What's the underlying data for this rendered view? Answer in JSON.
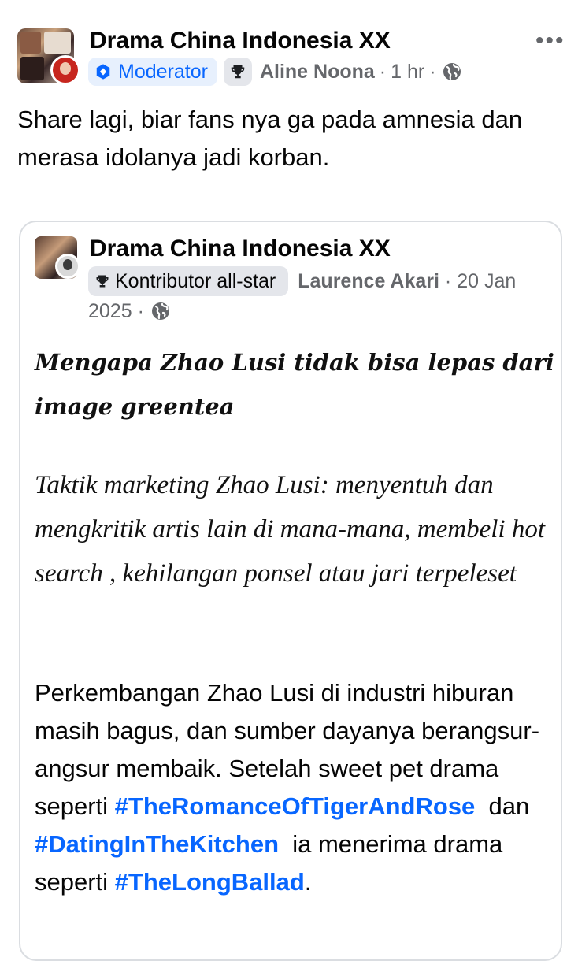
{
  "post": {
    "group_name": "Drama China Indonesia XX",
    "role_badge": "Moderator",
    "author": "Aline Noona",
    "time": "1 hr",
    "separator": "·",
    "more_icon": "more-horizontal-icon",
    "text": "Share lagi, biar fans nya ga pada amnesia dan merasa idolanya jadi korban."
  },
  "shared": {
    "group_name": "Drama China Indonesia XX",
    "role_badge": "Kontributor all-star",
    "author": "Laurence Akari",
    "date": "20 Jan 2025",
    "separator": "·",
    "title": "Mengapa Zhao Lusi tidak bisa lepas dari image greentea",
    "italic_paragraph": "Taktik marketing Zhao Lusi: menyentuh dan mengkritik artis lain di mana-mana, membeli hot search , kehilangan ponsel atau jari terpeleset",
    "body_part1": "Perkembangan Zhao Lusi di industri hiburan masih bagus, dan sumber dayanya berangsur-angsur membaik. Setelah sweet pet drama seperti ",
    "hashtag1": "#TheRomanceOfTigerAndRose",
    "body_part2": "  dan ",
    "hashtag2": "#DatingInTheKitchen",
    "body_part3": "  ia menerima drama seperti ",
    "hashtag3": "#TheLongBallad",
    "body_part4": "."
  },
  "colors": {
    "link_blue": "#0866ff",
    "meta_gray": "#65676b",
    "badge_blue_bg": "#e7f0fd",
    "chip_gray_bg": "#e4e6eb"
  },
  "icons": [
    "moderator-badge-icon",
    "trophy-icon",
    "globe-icon",
    "more-horizontal-icon"
  ]
}
